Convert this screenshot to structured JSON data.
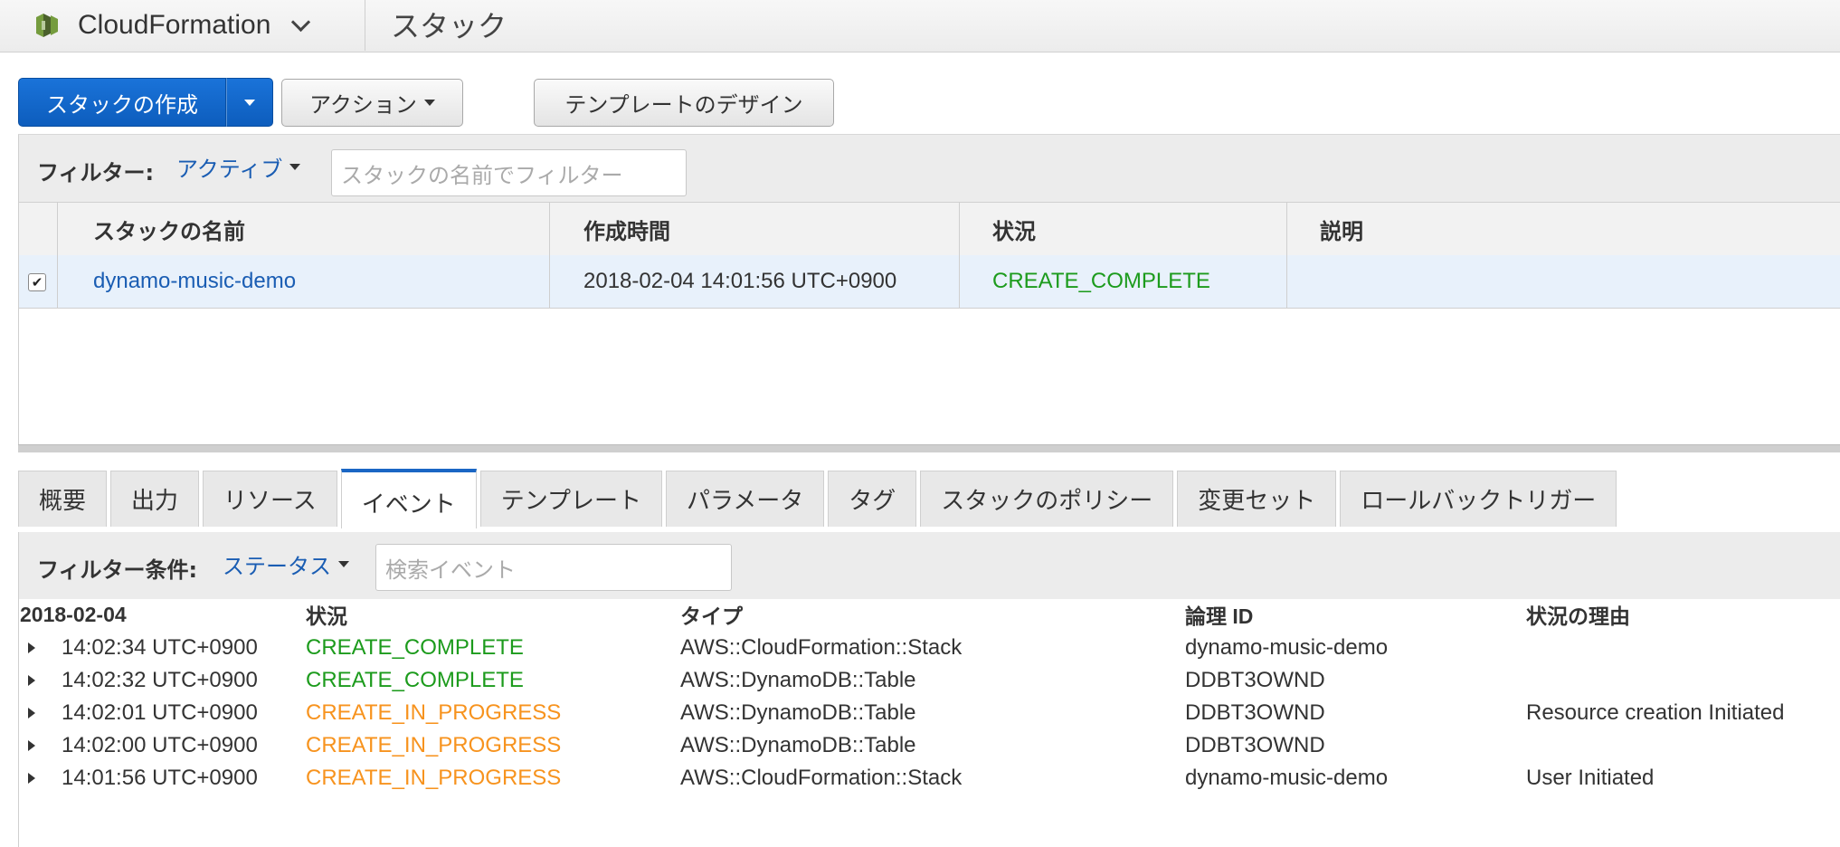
{
  "topbar": {
    "service_name": "CloudFormation",
    "breadcrumb": "スタック",
    "service_icon": "cloudformation-icon"
  },
  "toolbar": {
    "create_stack_label": "スタックの作成",
    "actions_label": "アクション",
    "design_template_label": "テンプレートのデザイン"
  },
  "stack_filter": {
    "label": "フィルター:",
    "status_value": "アクティブ",
    "search_placeholder": "スタックの名前でフィルター"
  },
  "stacks_table": {
    "columns": [
      "スタックの名前",
      "作成時間",
      "状況",
      "説明"
    ],
    "rows": [
      {
        "checked": true,
        "name": "dynamo-music-demo",
        "created": "2018-02-04 14:01:56 UTC+0900",
        "status": "CREATE_COMPLETE",
        "description": ""
      }
    ]
  },
  "tabs": [
    {
      "label": "概要"
    },
    {
      "label": "出力"
    },
    {
      "label": "リソース"
    },
    {
      "label": "イベント",
      "active": true
    },
    {
      "label": "テンプレート"
    },
    {
      "label": "パラメータ"
    },
    {
      "label": "タグ"
    },
    {
      "label": "スタックのポリシー"
    },
    {
      "label": "変更セット"
    },
    {
      "label": "ロールバックトリガー"
    }
  ],
  "event_filter": {
    "label": "フィルター条件:",
    "status_value": "ステータス",
    "search_placeholder": "検索イベント"
  },
  "events_table": {
    "date_header": "2018-02-04",
    "columns": [
      "状況",
      "タイプ",
      "論理 ID",
      "状況の理由"
    ],
    "rows": [
      {
        "time": "14:02:34 UTC+0900",
        "status": "CREATE_COMPLETE",
        "type": "AWS::CloudFormation::Stack",
        "logical_id": "dynamo-music-demo",
        "reason": ""
      },
      {
        "time": "14:02:32 UTC+0900",
        "status": "CREATE_COMPLETE",
        "type": "AWS::DynamoDB::Table",
        "logical_id": "DDBT3OWND",
        "reason": ""
      },
      {
        "time": "14:02:01 UTC+0900",
        "status": "CREATE_IN_PROGRESS",
        "type": "AWS::DynamoDB::Table",
        "logical_id": "DDBT3OWND",
        "reason": "Resource creation Initiated"
      },
      {
        "time": "14:02:00 UTC+0900",
        "status": "CREATE_IN_PROGRESS",
        "type": "AWS::DynamoDB::Table",
        "logical_id": "DDBT3OWND",
        "reason": ""
      },
      {
        "time": "14:01:56 UTC+0900",
        "status": "CREATE_IN_PROGRESS",
        "type": "AWS::CloudFormation::Stack",
        "logical_id": "dynamo-music-demo",
        "reason": "User Initiated"
      }
    ]
  },
  "colors": {
    "primary": "#0d5dbd",
    "link": "#1a5db3",
    "status_complete": "#1c9b1c",
    "status_in_progress": "#f7931e",
    "selected_row": "#e8f1fb"
  }
}
